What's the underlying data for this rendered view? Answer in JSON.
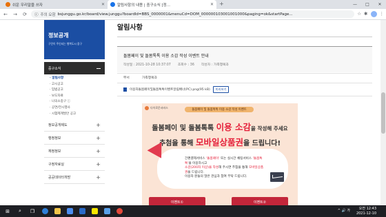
{
  "browser": {
    "tabs": [
      {
        "label": "쉬운 우리말을 쓰자",
        "active": false
      },
      {
        "label": "알림사항의 내용 | 중구소식 [정...",
        "active": true
      }
    ],
    "new_tab": "+",
    "window_controls": [
      "—",
      "□",
      "✕"
    ],
    "address": {
      "secure_label": "주의 요함",
      "url": "bsjunggu.go.kr/board/view.junggu?boardId=BBS_0000001&menuCd=DOM_000000103001001000&paging=ok&startPage..."
    }
  },
  "sidebar": {
    "title": "정보공개",
    "subtitle": "구민이 주인되는 행복도시 중구",
    "section": "중구소식",
    "subitems": [
      {
        "label": "· 알림사항",
        "active": true
      },
      {
        "label": "· 고시공고",
        "active": false
      },
      {
        "label": "· 입법공고",
        "active": false
      },
      {
        "label": "· 보도자료",
        "active": false
      },
      {
        "label": "· 나의소중구 ⓘ",
        "active": false
      },
      {
        "label": "· 공연/전시행사",
        "active": false
      },
      {
        "label": "· 시험제계발안 공고",
        "active": false
      }
    ],
    "menu": [
      "정보공개제도",
      "행정정보",
      "재정정보",
      "구정자료실",
      "공공데이터개방"
    ]
  },
  "main": {
    "page_title": "알림사항",
    "post": {
      "title": "돌봄페이 및 돌봄톡톡 이용 소감 작성 이벤트 안내",
      "date": "작성일 : 2021-10-28 10:37:07",
      "views": "조회수 : 36",
      "author": "작성자 : 가족행복과"
    },
    "dept_label": "부서",
    "dept_value": "가족행복과",
    "attachment": "이용자돌봄페이및돌봄톡톡이벤트알림배너(PC).png(95 kB)",
    "preview_label": "미리보기"
  },
  "poster": {
    "logo": "다이로운서비스",
    "banner": "돌봄페이 및 돌봄톡톡 이용 소감 작성 이벤트",
    "line1_a": "돌봄페이 및 돌봄톡톡 ",
    "line1_b": "이용 소감",
    "line1_c": "을 작성해 주세요",
    "line2_a": "추첨을 통해 ",
    "line2_b": "모바일상품권",
    "line2_c": "을 드립니다!",
    "card_1a": "간편결제서비스 ",
    "card_1b": "'돌봄페이'",
    "card_1c": " 또는 실시간 채팅서비스 ",
    "card_1d": "'돌봄톡톡'",
    "card_1e": "을 이용하시고",
    "card_2a": "소감(200자 이상)을 작성",
    "card_2b": "해 주시면 추첨을 통해 ",
    "card_2c": "모바일상품권",
    "card_2d": "을 드립니다.",
    "card_3": "이용자 분들의 많은 관심과 참여 부탁 드립니다.",
    "button1": "이벤트①",
    "button2": "이벤트②"
  },
  "taskbar": {
    "time": "오전 12:43",
    "date": "2021-12-10",
    "tray": "^  🔊  가"
  },
  "colors": {
    "sidebar_blue": "#1b4ea3",
    "accent_red": "#e5203a",
    "poster_bg": "#fbe4d5"
  }
}
